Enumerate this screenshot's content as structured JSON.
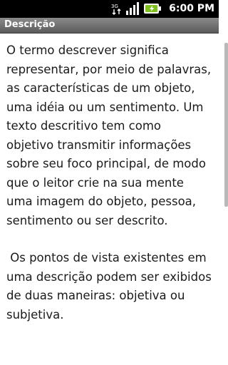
{
  "status_bar": {
    "network_type": "3G",
    "time": "6:00 PM",
    "icons": [
      "network-3g-icon",
      "signal-strength-icon",
      "battery-charging-icon"
    ]
  },
  "title_bar": {
    "title": "Descrição"
  },
  "content": {
    "paragraph_1": "O termo descrever significa representar, por meio de palavras, as características de um objeto, uma idéia ou um sentimento. Um texto descritivo tem como objetivo transmitir informações sobre seu foco principal, de modo que o leitor crie na sua mente uma imagem do objeto, pessoa, sentimento ou ser descrito.",
    "paragraph_2": " Os pontos de vista existentes em uma descrição podem ser exibidos de duas maneiras: objetiva ou subjetiva."
  },
  "colors": {
    "status_bar_bg": "#000000",
    "title_bar_bg": "#6e6e6e",
    "text": "#1a1a1a",
    "battery_green": "#7ec11d"
  }
}
